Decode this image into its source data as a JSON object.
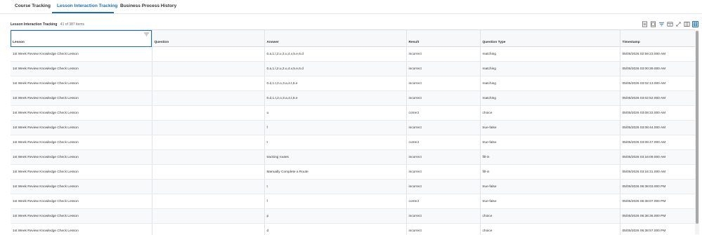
{
  "tabs": [
    {
      "label": "Course Tracking"
    },
    {
      "label": "Lesson Interaction Tracking"
    },
    {
      "label": "Business Process History"
    }
  ],
  "grid": {
    "title": "Lesson Interaction Tracking",
    "count": "41 of 387 items",
    "columns": [
      "Lesson",
      "Question",
      "Answer",
      "Result",
      "Question Type",
      "Timestamp"
    ],
    "rows": [
      [
        "1st Week Review Knowledge Check Lesson",
        "",
        "0.a,1.l,2.u,3.u,4.v,5.e,6.d",
        "incorrect",
        "matching",
        "05/05/2026 02:59:23.000 AM"
      ],
      [
        "1st Week Review Knowledge Check Lesson",
        "",
        "0.a,1.l,2.u,3.u,4.v,5.e,6.d",
        "incorrect",
        "matching",
        "05/05/2026 03:00:39.000 AM"
      ],
      [
        "1st Week Review Knowledge Check Lesson",
        "",
        "0.d,1.t,2.o,3.a,4.t,5.e",
        "incorrect",
        "matching",
        "05/05/2026 03:02:13.000 AM"
      ],
      [
        "1st Week Review Knowledge Check Lesson",
        "",
        "0.d,1.t,2.o,3.a,4.t,5.e",
        "incorrect",
        "matching",
        "05/05/2026 03:02:52.000 AM"
      ],
      [
        "1st Week Review Knowledge Check Lesson",
        "",
        "u",
        "correct",
        "choice",
        "05/05/2026 03:08:33.000 AM"
      ],
      [
        "1st Week Review Knowledge Check Lesson",
        "",
        "f",
        "incorrect",
        "true-false",
        "05/05/2026 03:08:44.000 AM"
      ],
      [
        "1st Week Review Knowledge Check Lesson",
        "",
        "t",
        "correct",
        "true-false",
        "05/05/2026 03:08:47.000 AM"
      ],
      [
        "1st Week Review Knowledge Check Lesson",
        "",
        "tracking routes",
        "incorrect",
        "fill-in",
        "05/05/2026 03:16:09.000 AM"
      ],
      [
        "1st Week Review Knowledge Check Lesson",
        "",
        "Manually Complete a Route",
        "incorrect",
        "fill-in",
        "05/05/2026 03:16:31.000 AM"
      ],
      [
        "1st Week Review Knowledge Check Lesson",
        "",
        "t",
        "incorrect",
        "true-false",
        "05/05/2026 06:38:03.000 PM"
      ],
      [
        "1st Week Review Knowledge Check Lesson",
        "",
        "f",
        "correct",
        "true-false",
        "05/05/2026 06:38:07.000 PM"
      ],
      [
        "1st Week Review Knowledge Check Lesson",
        "",
        "p",
        "incorrect",
        "choice",
        "05/05/2026 06:38:36.000 PM"
      ],
      [
        "1st Week Review Knowledge Check Lesson",
        "",
        "d",
        "incorrect",
        "choice",
        "05/05/2026 06:38:57.000 PM"
      ]
    ]
  },
  "toolbar_icons": [
    "export-excel-icon",
    "export-pdf-icon",
    "filter-icon",
    "column-chooser-icon",
    "fullscreen-icon",
    "table-view-icon",
    "grid-view-icon"
  ],
  "colors": {
    "accent": "#1a6fb5",
    "header_bg": "#f7f8f9",
    "border": "#e0e3e7"
  }
}
